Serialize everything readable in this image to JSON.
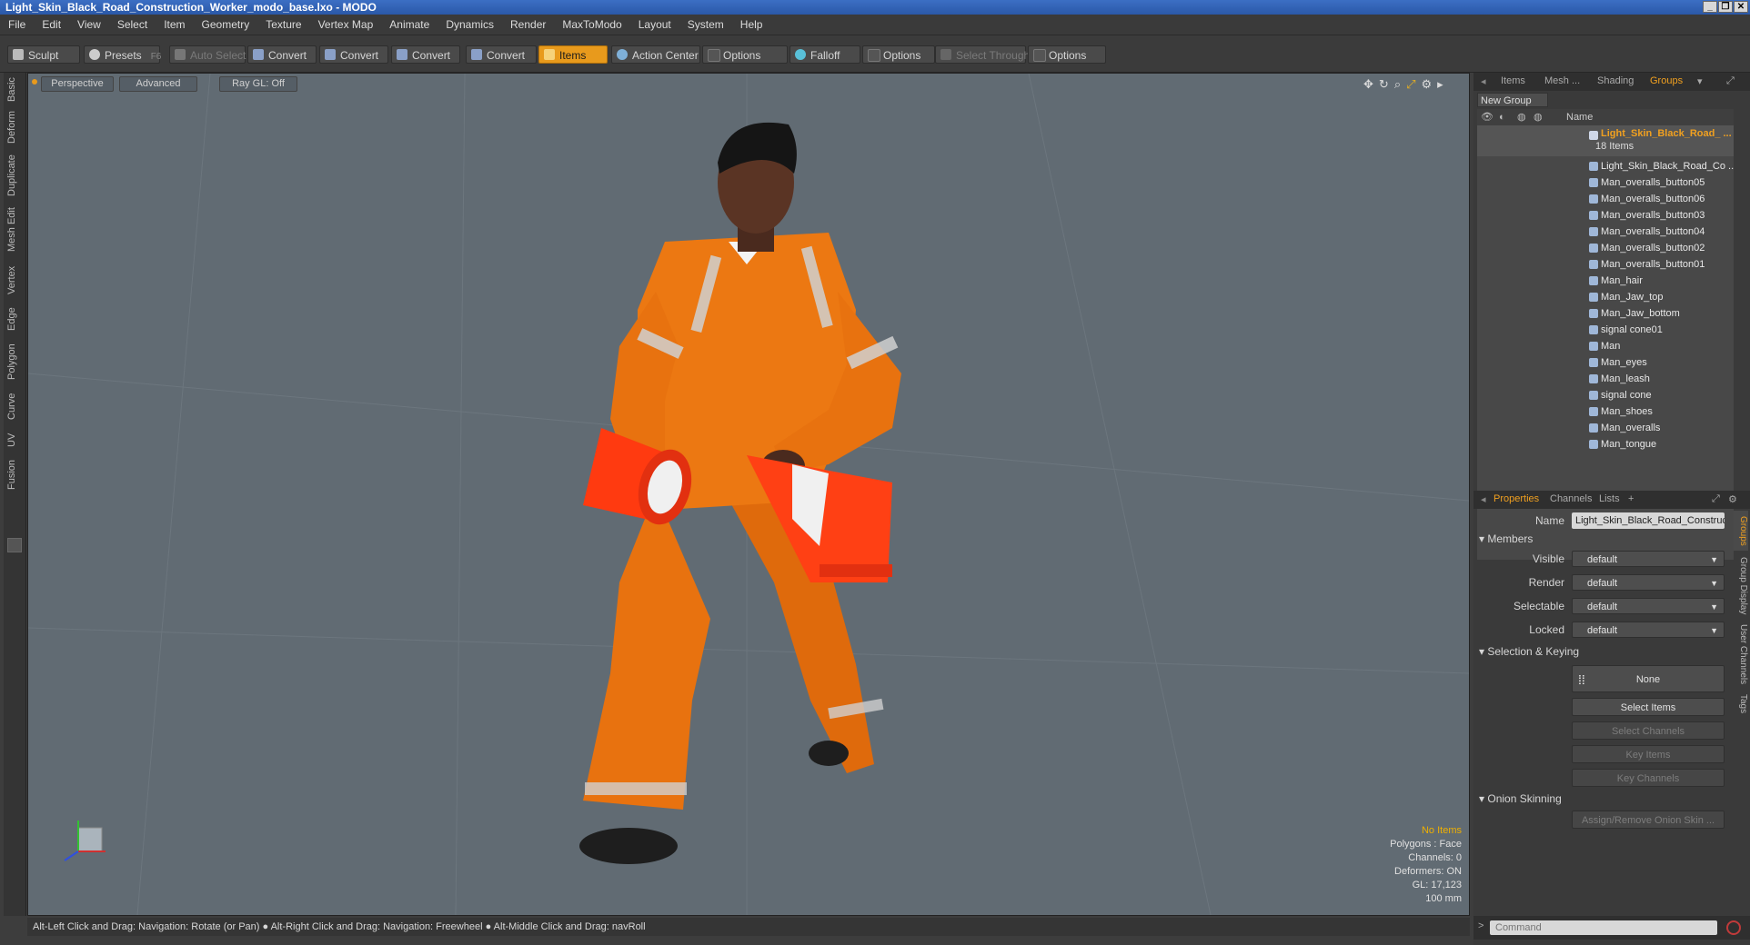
{
  "window": {
    "title": "Light_Skin_Black_Road_Construction_Worker_modo_base.lxo - MODO"
  },
  "menu": [
    "File",
    "Edit",
    "View",
    "Select",
    "Item",
    "Geometry",
    "Texture",
    "Vertex Map",
    "Animate",
    "Dynamics",
    "Render",
    "MaxToModo",
    "Layout",
    "System",
    "Help"
  ],
  "toolbar": {
    "sculpt": "Sculpt",
    "presets": "Presets",
    "presets_key": "F6",
    "auto_select": "Auto Select",
    "convert1": "Convert",
    "convert2": "Convert",
    "convert3": "Convert",
    "convert4": "Convert",
    "items": "Items",
    "action_center": "Action Center",
    "options1": "Options",
    "falloff": "Falloff",
    "options2": "Options",
    "select_through": "Select Through",
    "options3": "Options"
  },
  "left_tabs": [
    "Basic",
    "Deform",
    "Duplicate",
    "Mesh Edit",
    "Vertex",
    "Edge",
    "Polygon",
    "Curve",
    "UV",
    "Fusion"
  ],
  "viewport": {
    "view_mode": "Perspective",
    "shading": "Advanced",
    "raygl": "Ray GL: Off",
    "stats": {
      "items": "No Items",
      "polygons": "Polygons : Face",
      "channels": "Channels: 0",
      "deformers": "Deformers: ON",
      "gl": "GL: 17,123",
      "scale": "100 mm"
    }
  },
  "statusbar": {
    "text": "Alt-Left Click and Drag: Navigation: Rotate (or Pan) ● Alt-Right Click and Drag: Navigation: Freewheel ● Alt-Middle Click and Drag: navRoll"
  },
  "right_top_tabs": {
    "items": "Items",
    "mesh": "Mesh ...",
    "shading": "Shading",
    "groups": "Groups"
  },
  "groups": {
    "new_group": "New Group",
    "col_name": "Name",
    "root": {
      "name": "Light_Skin_Black_Road_ ...",
      "count": "18 Items"
    },
    "children": [
      "Light_Skin_Black_Road_Co ...",
      "Man_overalls_button05",
      "Man_overalls_button06",
      "Man_overalls_button03",
      "Man_overalls_button04",
      "Man_overalls_button02",
      "Man_overalls_button01",
      "Man_hair",
      "Man_Jaw_top",
      "Man_Jaw_bottom",
      "signal cone01",
      "Man",
      "Man_eyes",
      "Man_leash",
      "signal cone",
      "Man_shoes",
      "Man_overalls",
      "Man_tongue"
    ]
  },
  "right_bottom_tabs": {
    "properties": "Properties",
    "channels": "Channels",
    "lists": "Lists",
    "plus": "+"
  },
  "properties": {
    "name_label": "Name",
    "name_value": "Light_Skin_Black_Road_Construc",
    "members": "Members",
    "visible_label": "Visible",
    "visible_value": "default",
    "render_label": "Render",
    "render_value": "default",
    "selectable_label": "Selectable",
    "selectable_value": "default",
    "locked_label": "Locked",
    "locked_value": "default",
    "selection_keying": "Selection & Keying",
    "none": "None",
    "select_items": "Select Items",
    "select_channels": "Select Channels",
    "key_items": "Key Items",
    "key_channels": "Key Channels",
    "onion": "Onion Skinning",
    "assign_onion": "Assign/Remove Onion Skin ..."
  },
  "right_vertical_tabs": [
    "Groups",
    "Group Display",
    "User Channels",
    "Tags"
  ],
  "command": {
    "placeholder": "Command"
  },
  "colors": {
    "accent": "#e89a1c",
    "selected_text": "#f0a020",
    "viewport_bg": "#616b73",
    "overalls": "#e8720f"
  }
}
